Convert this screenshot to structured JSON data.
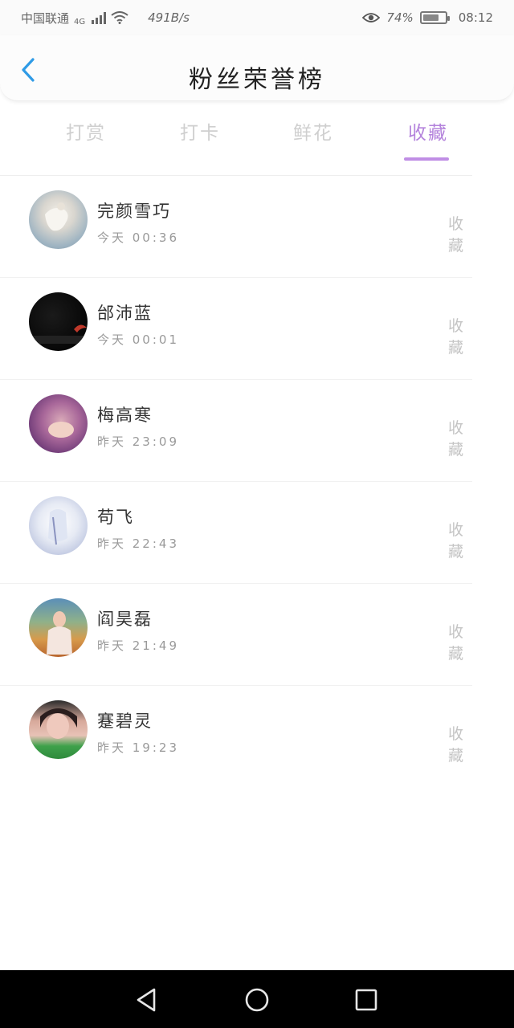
{
  "status_bar": {
    "carrier": "中国联通",
    "network": "4G",
    "speed": "491B/s",
    "battery": "74%",
    "battery_level": 0.74,
    "time": "08:12"
  },
  "header": {
    "title": "粉丝荣誉榜"
  },
  "tabs": [
    {
      "label": "打赏",
      "active": false
    },
    {
      "label": "打卡",
      "active": false
    },
    {
      "label": "鲜花",
      "active": false
    },
    {
      "label": "收藏",
      "active": true
    }
  ],
  "fans": [
    {
      "name": "完颜雪巧",
      "time": "今天 00:36",
      "action": "收藏"
    },
    {
      "name": "邰沛蓝",
      "time": "今天 00:01",
      "action": "收藏"
    },
    {
      "name": "梅高寒",
      "time": "昨天 23:09",
      "action": "收藏"
    },
    {
      "name": "苟飞",
      "time": "昨天 22:43",
      "action": "收藏"
    },
    {
      "name": "阎昊磊",
      "time": "昨天 21:49",
      "action": "收藏"
    },
    {
      "name": "蹇碧灵",
      "time": "昨天 19:23",
      "action": "收藏"
    }
  ],
  "colors": {
    "accent": "#b483dc",
    "back_arrow": "#2f9be6"
  },
  "icons": {
    "back": "chevron-left-icon",
    "nav_back": "triangle-back-icon",
    "nav_home": "circle-home-icon",
    "nav_recent": "square-recent-icon"
  }
}
